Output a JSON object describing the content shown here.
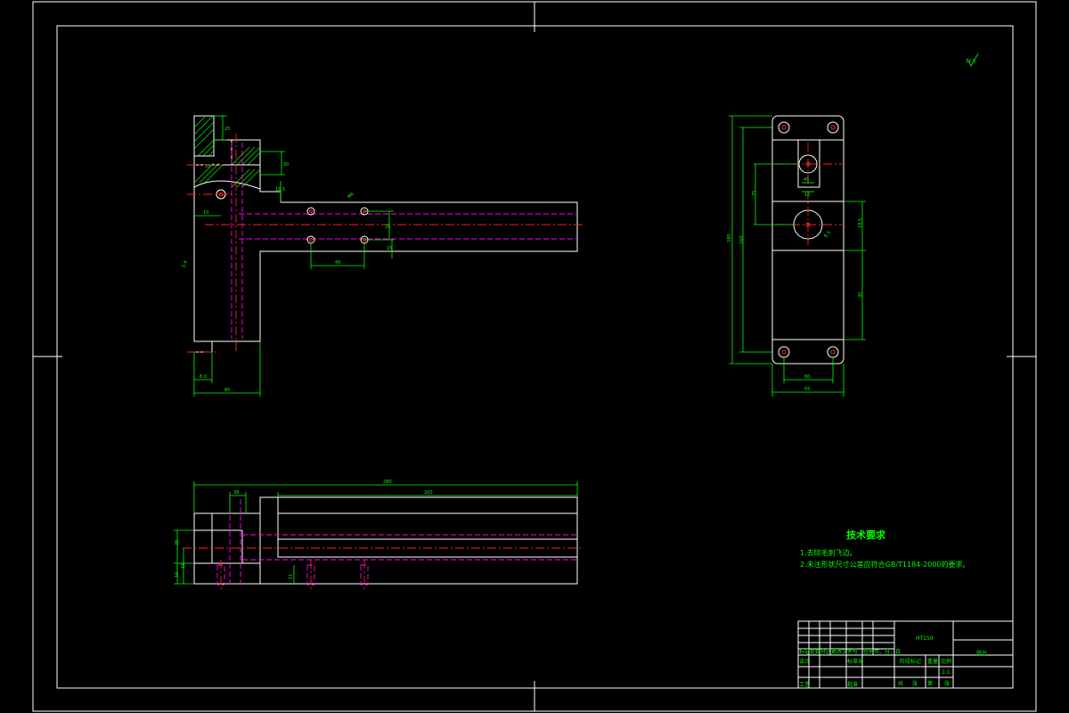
{
  "tech_requirements": {
    "heading": "技术要求",
    "items": [
      "1.去除毛刺飞边。",
      "2.未注形状尺寸公差应符合GB/T1184-2000的要求。"
    ]
  },
  "roughness_symbol": "12.5",
  "title_block": {
    "material": "HT150",
    "part_name": "钳台",
    "row_labels": [
      "标记",
      "处数",
      "分区",
      "更改文件号",
      "签名",
      "年、月、日"
    ],
    "design_label": "设计",
    "standardization_label": "标准化",
    "process_label": "工艺",
    "approve_label": "批准",
    "stage_label": "阶段标记",
    "weight_label": "重量",
    "scale_label": "比例",
    "scale_value": "1:1",
    "sheet_labels": [
      "共",
      "张",
      "第",
      "张"
    ]
  },
  "dims": {
    "top_view": [
      "25",
      "50",
      "10",
      "18.5",
      "M6",
      "10",
      "25",
      "15",
      "45",
      "5.4",
      "60",
      "8.0",
      "10"
    ],
    "side_view": [
      "180",
      "160",
      "75",
      "45",
      "10",
      "8.5",
      "19.5",
      "30",
      "55",
      "60",
      "45"
    ],
    "front_view": [
      "280",
      "38",
      "200",
      "20",
      "16",
      "16",
      "11"
    ]
  }
}
